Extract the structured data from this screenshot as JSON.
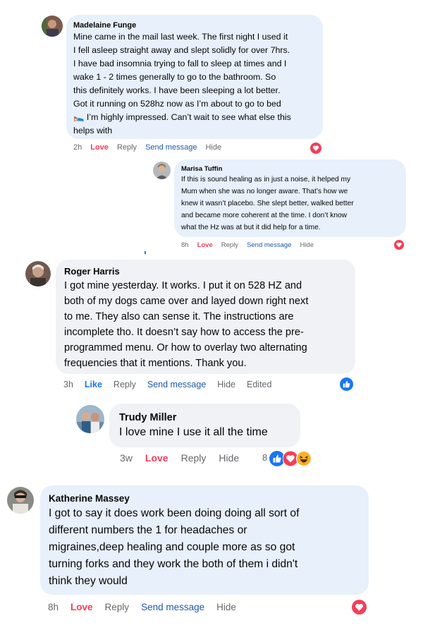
{
  "comments": [
    {
      "name": "Madelaine Funge",
      "text_lines": [
        "Mine came in the mail last week. The first night I used it",
        "I fell asleep straight away and slept solidly for over 7hrs.",
        "I have bad insomnia trying to fall to sleep at times and I",
        "wake 1 - 2 times generally to go to the bathroom. So",
        "this definitely works. I have been sleeping a lot better.",
        "Got it running on 528hz now as I’m about to go to bed",
        "🛌 I’m highly impressed. Can’t wait to see what else this",
        "helps with"
      ],
      "time": "2h",
      "reaction_label": "Love",
      "reply": "Reply",
      "send": "Send message",
      "hide": "Hide",
      "reaction_icon": "love-icon"
    },
    {
      "name": "Marisa Tuffin",
      "text_lines": [
        "If this is sound healing as in just a noise, it helped my",
        "Mum when she was no longer aware. That’s how we",
        "knew it wasn’t placebo. She slept better, walked better",
        "and became more coherent at the time. I don’t know",
        "what the Hz was at but it did help for a time."
      ],
      "time": "8h",
      "reaction_label": "Love",
      "reply": "Reply",
      "send": "Send message",
      "hide": "Hide",
      "reaction_icon": "love-icon"
    },
    {
      "name": "Roger Harris",
      "text_lines": [
        "I got mine yesterday. It works. I put it on 528 HZ and",
        "both of my dogs came over and layed down right next",
        "to me. They also can sense it. The instructions are",
        "incomplete tho. It doesn’t say how to access the pre-",
        "programmed menu. Or how to overlay two alternating",
        "frequencies that it mentions. Thank you."
      ],
      "time": "3h",
      "reaction_label": "Like",
      "reply": "Reply",
      "send": "Send message",
      "hide": "Hide",
      "edited": "Edited",
      "reaction_icon": "like-icon"
    },
    {
      "name": "Trudy Miller",
      "text_lines": [
        "I love mine I use it all the time"
      ],
      "time": "3w",
      "reaction_label": "Love",
      "reply": "Reply",
      "hide": "Hide",
      "reaction_count": "8",
      "reaction_icons": [
        "like-icon",
        "love-icon",
        "haha-icon"
      ]
    },
    {
      "name": "Katherine Massey",
      "text_lines": [
        "I got to say it does work been doing doing all sort of",
        "different numbers the 1 for headaches or",
        "migraines,deep healing and couple more as so got",
        "turning forks and they work the both of them i didn't",
        "think they would"
      ],
      "time": "8h",
      "reaction_label": "Love",
      "reply": "Reply",
      "send": "Send message",
      "hide": "Hide",
      "reaction_icon": "love-icon"
    }
  ],
  "colors": {
    "bubble_blue": "#e7f0fb",
    "bubble_grey": "#f0f2f5",
    "love": "#f33e58",
    "like": "#1877f2",
    "meta": "#65676b"
  }
}
